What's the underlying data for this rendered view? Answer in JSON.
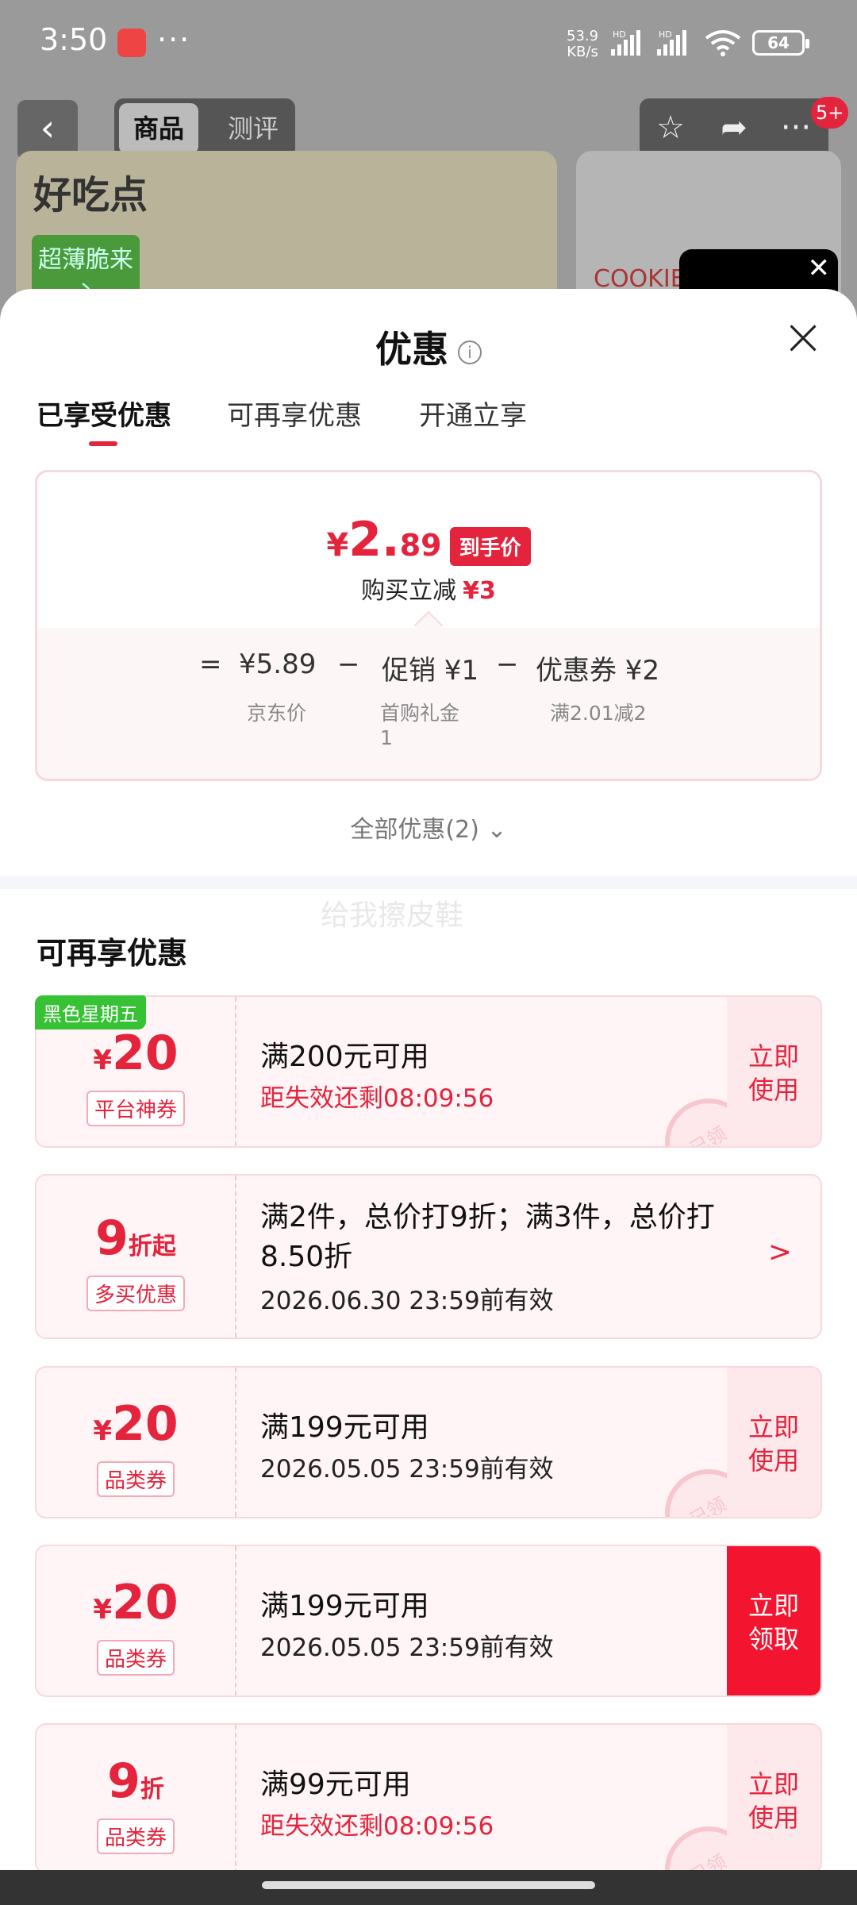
{
  "status_bar": {
    "time": "3:50",
    "more_dots": "···",
    "net_speed_top": "53.9",
    "net_speed_bottom": "KB/s",
    "signal1_label": "HD",
    "signal2_label": "HD",
    "battery": "64"
  },
  "product_header": {
    "tabs": [
      "商品",
      "测评"
    ],
    "badge": "5+",
    "brand_logo": "好吃点",
    "brand_tag": "超薄脆来心",
    "second_product_text": "COOKIE",
    "icons": [
      "back-icon",
      "star-icon",
      "share-icon",
      "more-icon",
      "close-icon"
    ]
  },
  "sheet": {
    "title": "优惠",
    "tabs": [
      "已享受优惠",
      "可再享优惠",
      "开通立享"
    ],
    "price_card": {
      "currency": "¥",
      "price_int": "2.",
      "price_dec": "89",
      "price_tag": "到手价",
      "buy_less_label": "购买立减",
      "buy_less_value": "¥3",
      "formula": {
        "equals": "=",
        "jd_price": "¥5.89",
        "jd_price_label": "京东价",
        "minus1": "−",
        "promo": "促销 ¥1",
        "promo_label_line1": "首购礼金",
        "promo_label_line2": "1",
        "minus2": "−",
        "coupon": "优惠券 ¥2",
        "coupon_label": "满2.01减2"
      }
    },
    "all_offers": "全部优惠(2)",
    "watermark": "给我擦皮鞋",
    "section_title": "可再享优惠",
    "coupons": [
      {
        "badge": "黑色星期五",
        "currency": "¥",
        "amount": "20",
        "unit": "",
        "type": "平台神券",
        "main": "满200元可用",
        "sub": "距失效还剩08:09:56",
        "action": "立即\n使用",
        "stamp": "已领"
      },
      {
        "currency": "",
        "amount": "9",
        "unit": "折起",
        "type": "多买优惠",
        "main_line1": "满2件，总价打9折；满3件，总价打",
        "main_line2": "8.50折",
        "sub": "2026.06.30 23:59前有效",
        "action": ">"
      },
      {
        "currency": "¥",
        "amount": "20",
        "unit": "",
        "type": "品类券",
        "main": "满199元可用",
        "sub": "2026.05.05 23:59前有效",
        "action": "立即\n使用",
        "stamp": "已领"
      },
      {
        "currency": "¥",
        "amount": "20",
        "unit": "",
        "type": "品类券",
        "main": "满199元可用",
        "sub": "2026.05.05 23:59前有效",
        "action": "立即\n领取"
      },
      {
        "currency": "",
        "amount": "9",
        "unit": "折",
        "type": "品类券",
        "main": "满99元可用",
        "sub": "距失效还剩08:09:56",
        "action": "立即\n使用",
        "stamp": "已领"
      }
    ]
  },
  "colors": {
    "accent_red": "#e4233c",
    "green_badge": "#37c236",
    "card_border": "#f7d8dd",
    "card_bg": "#fff5f6"
  }
}
